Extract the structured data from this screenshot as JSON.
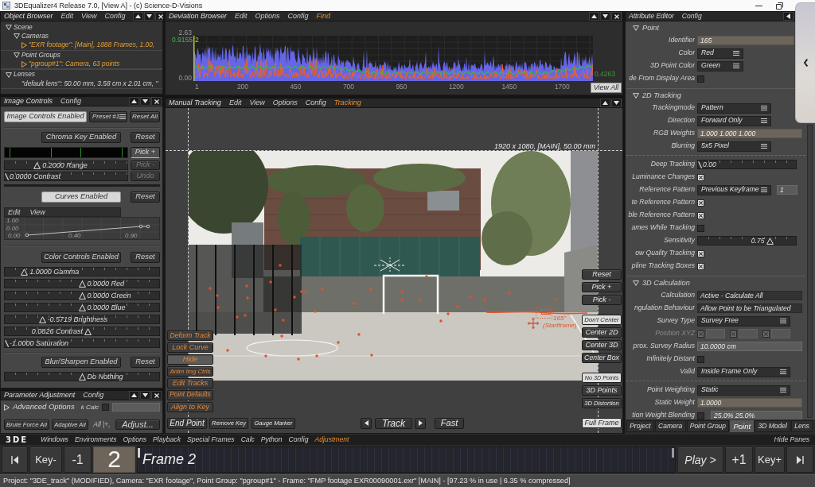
{
  "window": {
    "title": "3DEqualizer4 Release 7.0, [View A] - (c) Science-D-Visions"
  },
  "object_browser": {
    "title": "Object Browser",
    "menus": [
      "Edit",
      "View",
      "Config"
    ],
    "tree": [
      {
        "label": "Scene",
        "expanded": true,
        "selected": false,
        "children": [
          {
            "label": "Cameras",
            "expanded": true,
            "selected": false,
            "children": [
              {
                "label": "\"EXR footage\": [Main], 1888 Frames, 1.00,",
                "expanded": false,
                "selected": true
              }
            ]
          },
          {
            "label": "Point Groups",
            "expanded": true,
            "selected": false,
            "children": [
              {
                "label": "\"pgroup#1\": Camera, 63 points",
                "expanded": false,
                "selected": true
              }
            ]
          }
        ]
      },
      {
        "label": "Lenses",
        "expanded": true,
        "selected": false,
        "children": [
          {
            "label": "\"default lens\": 50.00 mm, 3.58 cm x 2.01 cm, \"",
            "selected": false
          }
        ]
      }
    ]
  },
  "image_controls": {
    "title": "Image Controls",
    "menus": [
      "Config"
    ],
    "enable": {
      "label": "Image Controls Enabled",
      "on": true
    },
    "preset": "Preset #1",
    "reset_all": "Reset All",
    "chroma": {
      "toggle": {
        "label": "Chroma Key Enabled",
        "on": false
      },
      "reset": "Reset",
      "sliders": [
        {
          "label": "0.2000 Range",
          "level": 0.25
        },
        {
          "label": "0.0000 Contrast",
          "level": 0
        }
      ],
      "buttons": [
        {
          "label": "Pick +",
          "disabled": false
        },
        {
          "label": "Pick -",
          "disabled": true
        },
        {
          "label": "Undo",
          "disabled": true
        }
      ]
    },
    "curves": {
      "toggle": {
        "label": "Curves Enabled",
        "on": true
      },
      "reset": "Reset",
      "menus": [
        "Edit",
        "View"
      ],
      "y_labels": [
        "1.00",
        "0.00"
      ],
      "x_labels": [
        "0.00",
        "0.40",
        "0.90"
      ]
    },
    "color": {
      "toggle": {
        "label": "Color Controls Enabled",
        "on": false
      },
      "reset": "Reset",
      "sliders": [
        {
          "label": "1.0000 Gamma",
          "level": 0.11
        },
        {
          "label": "0.0000 Red",
          "level": 0.5
        },
        {
          "label": "0.0000 Green",
          "level": 0.5
        },
        {
          "label": "0.0000 Blue",
          "level": 0.5
        },
        {
          "label": "-0.5719 Brightness",
          "level": 0.23
        },
        {
          "label": "0.0826 Contrast",
          "level": 0.54
        },
        {
          "label": "-1.0000 Saturation",
          "level": 0
        }
      ]
    },
    "blur": {
      "toggle": {
        "label": "Blur/Sharpen Enabled",
        "on": false
      },
      "reset": "Reset",
      "sliders": [
        {
          "label": "Do Nothing",
          "level": 0.5
        }
      ]
    }
  },
  "parameter_adjustment": {
    "title": "Parameter Adjustment",
    "menus": [
      "Config"
    ],
    "advanced": {
      "label": "Advanced Options",
      "expanded": false
    },
    "calc": {
      "label": "k Calc",
      "checked": false
    },
    "buttons": [
      "Brute Force All",
      "Adaptive All",
      "All |+,",
      "Adjust..."
    ]
  },
  "deviation_browser": {
    "title": "Deviation Browser",
    "menus": [
      "Edit",
      "Options",
      "Config"
    ],
    "mode": "Find",
    "y_max": "2.63",
    "y_min": "0.00",
    "marker_value": "0.9155",
    "marker_frame": "2",
    "end_value": "0.4263",
    "x_labels": [
      "1",
      "200",
      "450",
      "700",
      "950",
      "1200",
      "1450",
      "1700"
    ],
    "view_all": "View All"
  },
  "manual_tracking": {
    "title": "Manual Tracking",
    "menus": [
      "Edit",
      "View",
      "Options",
      "Config"
    ],
    "mode": "Tracking",
    "image_info": "1920 x 1080, [MAIN], 50.00 mm",
    "point_id": "165\"",
    "point_note": "(Startframe)",
    "left_tools": [
      {
        "label": "Deform Track",
        "selected": false
      },
      {
        "label": "Lock Curve",
        "selected": false
      },
      {
        "label": "Hide",
        "selected": true
      },
      {
        "label": "Anim Img Ctrls",
        "selected": false
      },
      {
        "label": "Edit Tracks",
        "selected": false
      },
      {
        "label": "Point Defaults",
        "selected": false
      },
      {
        "label": "Align to Key",
        "selected": false
      }
    ],
    "right_tools": [
      [
        {
          "label": "Reset",
          "selected": false
        },
        {
          "label": "Pick +",
          "selected": false
        },
        {
          "label": "Pick -",
          "selected": false
        }
      ],
      [
        {
          "label": "Don't Center",
          "selected": true
        },
        {
          "label": "Center 2D",
          "selected": false
        },
        {
          "label": "Center 3D",
          "selected": false
        },
        {
          "label": "Center Box",
          "selected": false
        }
      ],
      [
        {
          "label": "No 3D Points",
          "selected": true
        },
        {
          "label": "3D Points",
          "selected": false
        },
        {
          "label": "3D Distortion",
          "selected": false
        }
      ],
      [
        {
          "label": "Full Frame",
          "selected": true
        }
      ]
    ],
    "bottom_tools": [
      "End Point",
      "Remove Key",
      "Gauge Marker"
    ],
    "track": "Track",
    "fast": "Fast"
  },
  "attribute_editor": {
    "title": "Attribute Editor",
    "menus": [
      "Config"
    ],
    "sections": [
      {
        "title": "Point",
        "expanded": true,
        "groups": [
          [
            {
              "kind": "field",
              "label": "Identifier",
              "value": "165",
              "disabled": false
            },
            {
              "kind": "dropdown",
              "label": "Color",
              "value": "Red",
              "disabled": false
            },
            {
              "kind": "dropdown",
              "label": "3D Point Color",
              "value": "Green",
              "disabled": false
            },
            {
              "kind": "checkbox",
              "label": "de From Display Area",
              "checked": false,
              "disabled": false
            }
          ]
        ]
      },
      {
        "title": "2D Tracking",
        "expanded": true,
        "groups": [
          [
            {
              "kind": "dropdown",
              "label": "Trackingmode",
              "value": "Pattern",
              "disabled": false
            },
            {
              "kind": "dropdown",
              "label": "Direction",
              "value": "Forward Only",
              "disabled": false
            },
            {
              "kind": "field",
              "label": "RGB Weights",
              "value": "1.000 1.000 1.000",
              "disabled": false
            },
            {
              "kind": "dropdown",
              "label": "Blurring",
              "value": "5x5 Pixel",
              "disabled": false
            }
          ],
          [
            {
              "kind": "slider",
              "label": "Deep Tracking",
              "value": "0.00",
              "level": 0,
              "disabled": false
            },
            {
              "kind": "checkbox",
              "label": "Luminance Changes",
              "checked": true,
              "disabled": false
            },
            {
              "kind": "dropdown",
              "label": "Reference Pattern",
              "value": "Previous Keyframe",
              "extra": "1",
              "disabled": false
            },
            {
              "kind": "checkbox",
              "label": "te Reference Pattern",
              "checked": true,
              "disabled": false
            },
            {
              "kind": "checkbox",
              "label": "ble Reference Pattern",
              "checked": true,
              "disabled": false
            },
            {
              "kind": "checkbox",
              "label": "ames While Tracking",
              "checked": false,
              "disabled": false
            },
            {
              "kind": "slider",
              "label": "Sensitivity",
              "value": "0.75",
              "level": 0.75,
              "disabled": false
            },
            {
              "kind": "checkbox",
              "label": "ow Quality Tracking",
              "checked": true,
              "disabled": false
            },
            {
              "kind": "checkbox",
              "label": "pline Tracking Boxes",
              "checked": true,
              "disabled": false
            }
          ]
        ]
      },
      {
        "title": "3D Calculation",
        "expanded": true,
        "groups": [
          [
            {
              "kind": "readout",
              "label": "Calculation",
              "value": "Active - Calculate All",
              "disabled": false
            },
            {
              "kind": "readout",
              "label": "ngulation Behaviour",
              "value": "Allow Point to be Triangulated",
              "disabled": false
            },
            {
              "kind": "dropdown",
              "label": "Survey Type",
              "value": "Survey Free",
              "disabled": false
            },
            {
              "kind": "xyz",
              "label": "Position XYZ",
              "disabled": true,
              "axes": [
                {
                  "checked": true
                },
                {
                  "checked": true
                },
                {
                  "checked": true
                }
              ]
            },
            {
              "kind": "entry",
              "label": "prox. Survey Radius",
              "value": "10.0000 cm",
              "disabled": false
            },
            {
              "kind": "checkbox",
              "label": "Infinitely Distant",
              "checked": false,
              "disabled": false
            },
            {
              "kind": "dropdown",
              "label": "Valid",
              "value": "Inside Frame Only",
              "disabled": false
            }
          ],
          [
            {
              "kind": "dropdown",
              "label": "Point Weighting",
              "value": "Static",
              "disabled": false
            },
            {
              "kind": "field",
              "label": "Static Weight",
              "value": "1.0000",
              "disabled": false
            },
            {
              "kind": "checkbox",
              "label": "tion Weight Blending",
              "checked": false,
              "value": "25.0% 25.0%",
              "disabled": false
            }
          ]
        ]
      }
    ],
    "tabs": [
      {
        "label": "Project",
        "selected": false
      },
      {
        "label": "Camera",
        "selected": false
      },
      {
        "label": "Point Group",
        "selected": false
      },
      {
        "label": "Point",
        "selected": true
      },
      {
        "label": "3D Model",
        "selected": false
      },
      {
        "label": "Lens",
        "selected": false
      }
    ]
  },
  "main_menu": {
    "logo": "3DE",
    "items": [
      "Windows",
      "Environments",
      "Options",
      "Playback",
      "Special Frames",
      "Calc",
      "Python",
      "Config"
    ],
    "mode": "Adjustment",
    "hide_panes": "Hide Panes"
  },
  "timeline": {
    "key_prev": "Key-",
    "step_back": "-1",
    "frame": "2",
    "label": "Frame 2",
    "play": "Play >",
    "step_forward": "+1",
    "key_next": "Key+"
  },
  "status_bar": {
    "text": "Project: \"3DE_track\" (MODIFIED), Camera: \"EXR footage\", Point Group: \"pgroup#1\" - Frame: \"FMP footage EXR00090001.exr\" [MAIN] - [97.23 % in use | 6.35 % compressed]"
  }
}
